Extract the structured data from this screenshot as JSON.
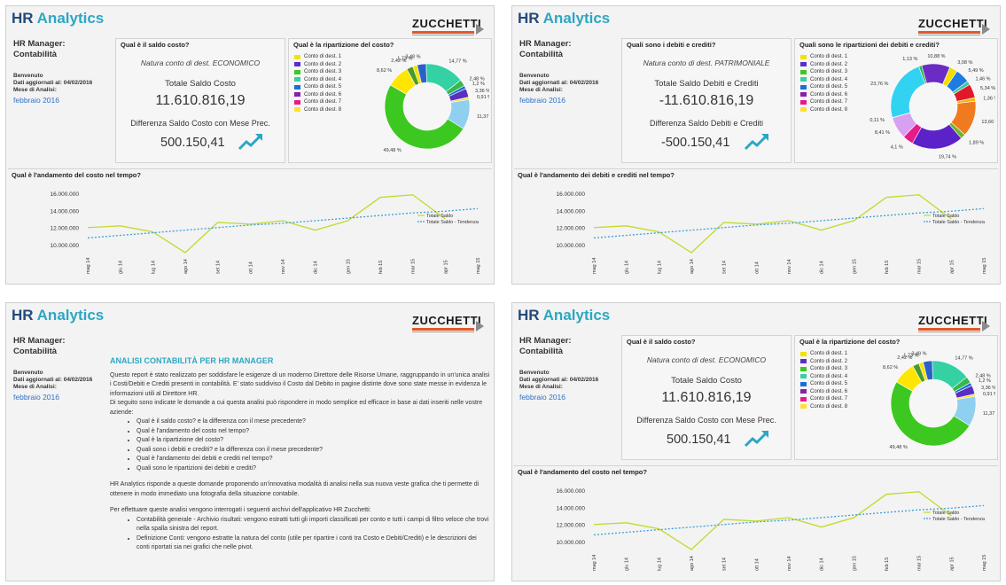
{
  "common": {
    "title_hr": "HR",
    "title_analytics": "Analytics",
    "logo": "ZUCCHETTI",
    "manager_line1": "HR Manager:",
    "manager_line2": "Contabilità",
    "welcome": "Benvenuto",
    "updated": "Dati aggiornati al: 04/02/2016",
    "month_label": "Mese di Analisi:",
    "month_value": "febbraio 2016",
    "trend_up_icon": "trend-up-arrow",
    "colors": {
      "title_dark": "#244a79",
      "title_accent": "#2ca7c3",
      "month_link": "#2f71c8",
      "trend_line": "#c2d92a",
      "regression_line": "#3a9fd8"
    }
  },
  "panel_cost": {
    "q1": "Qual è il saldo costo?",
    "nature": "Natura conto di dest. ECONOMICO",
    "total_label": "Totale Saldo Costo",
    "total_value": "11.610.816,19",
    "diff_label": "Differenza Saldo Costo con Mese Prec.",
    "diff_value": "500.150,41",
    "q2": "Qual è la ripartizione del costo?",
    "q3": "Qual è l'andamento  del costo nel tempo?"
  },
  "panel_debts": {
    "q1": "Quali sono i debiti e crediti?",
    "nature": "Natura conto di dest. PATRIMONIALE",
    "total_label": "Totale Saldo Debiti e Crediti",
    "total_value": "-11.610.816,19",
    "diff_label": "Differenza Saldo Debiti e Crediti",
    "diff_value": "-500.150,41",
    "q2": "Quali sono le ripartizioni dei debiti e crediti?",
    "q3": "Qual è l'andamento  dei debiti e crediti nel tempo?"
  },
  "panel_intro": {
    "heading": "ANALISI CONTABILITÀ PER HR MANAGER",
    "para1": "Questo report è stato realizzato per soddisfare le esigenze di un moderno Direttore delle Risorse Umane, raggruppando in un'unica analisi i Costi/Debiti e Crediti presenti in contabilità. E' stato suddiviso il Costo dal Debito in pagine distinte dove sono state messe in evidenza le informazioni utili al Direttore HR.",
    "para2": "Di seguito sono indicate le domande a cui questa analisi può rispondere in modo semplice ed efficace in base ai dati inseriti nelle vostre aziende:",
    "bullets1": [
      "Qual è il saldo costo? e la differenza con il mese precedente?",
      "Qual è l'andamento del costo nel tempo?",
      "Qual è la ripartizione del costo?",
      "Quali sono i debiti e crediti? e la differenza con il mese precedente?",
      "Qual è l'andamento dei debiti e crediti nel tempo?",
      "Quali sono le ripartizioni dei debiti e crediti?"
    ],
    "para3": "HR Analytics risponde a queste domande proponendo un'innovativa modalità di analisi nella sua nuova veste grafica che ti permette di ottenere in modo immediato una fotografia della situazione contabile.",
    "para4": "Per effettuare queste analisi vengono interrogati i seguenti archivi dell'applicativo HR Zucchetti:",
    "bullets2": [
      "Contabilità generale - Archivio risultati: vengono estratti tutti gli importi classificati per conto e tutti i campi di filtro veloce che trovi nella spalla sinistra del report.",
      "Definizione Conti: vengono estratte la natura del conto (utile per ripartire i conti tra Costo e Debiti/Crediti) e le descrizioni dei conti riportati sia nei grafici che nelle pivot."
    ]
  },
  "legend_labels": [
    "Conto di dest. 1",
    "Conto di dest. 2",
    "Conto di dest. 3",
    "Conto di dest. 4",
    "Conto di dest. 5",
    "Conto di dest. 6",
    "Conto di dest. 7",
    "Conto di dest. 8"
  ],
  "chart_data": [
    {
      "type": "pie",
      "title": "Qual è la ripartizione del costo?",
      "labels": [
        "1,73 %",
        "3,48 %",
        "14,77 %",
        "2,48 %",
        "1,2 %",
        "3,36 %",
        "0,91 %",
        "11,37 %",
        "49,48 %",
        "8,62 %",
        "2,42 %"
      ],
      "values": [
        1.73,
        3.48,
        14.77,
        2.48,
        1.2,
        3.36,
        0.91,
        11.37,
        49.48,
        8.62,
        2.42
      ],
      "colors": [
        "#f2e200",
        "#2d5fcc",
        "#34d1a5",
        "#38b84a",
        "#1a6fd6",
        "#5a2fc4",
        "#ffe030",
        "#8fd0f0",
        "#3cc820",
        "#ffe600",
        "#4a9a2a"
      ]
    },
    {
      "type": "pie",
      "title": "Quali sono le ripartizioni dei debiti e crediti?",
      "labels": [
        "1,13 %",
        "10,88 %",
        "3,08 %",
        "5,49 %",
        "1,46 %",
        "5,34 %",
        "1,36 %",
        "13,66 %",
        "1,89 %",
        "19,74 %",
        "4,1 %",
        "8,41 %",
        "0,11 %",
        "23,76 %"
      ],
      "values": [
        1.13,
        10.88,
        3.08,
        5.49,
        1.46,
        5.34,
        1.36,
        13.66,
        1.89,
        19.74,
        4.1,
        8.41,
        0.11,
        23.76
      ],
      "colors": [
        "#2fb640",
        "#6a2cc4",
        "#f2de00",
        "#1e7be0",
        "#39c9a0",
        "#e0182a",
        "#f5b700",
        "#f07a20",
        "#6ab82a",
        "#5a22c8",
        "#e81a8a",
        "#d8a0f0",
        "#9a9a9a",
        "#31d2f2"
      ]
    },
    {
      "type": "line",
      "title": "Qual è l'andamento  del costo nel tempo?",
      "x": [
        "mag 14",
        "giu 14",
        "lug 14",
        "ago 14",
        "set 14",
        "ott 14",
        "nov 14",
        "dic 14",
        "gen 15",
        "feb 15",
        "mar 15",
        "apr 15",
        "mag 15"
      ],
      "series": [
        {
          "name": "Totale Saldo",
          "values": [
            12100000,
            12300000,
            11600000,
            9200000,
            12700000,
            12500000,
            12900000,
            11800000,
            12900000,
            15600000,
            15900000,
            13100000,
            null
          ]
        },
        {
          "name": "Totale Saldo - Tendenza",
          "values": [
            10900000,
            11200000,
            11500000,
            11800000,
            12100000,
            12400000,
            12600000,
            12900000,
            13200000,
            13500000,
            13800000,
            14000000,
            14300000
          ]
        }
      ],
      "ylim": [
        9200000,
        16800000
      ],
      "yticks": [
        "16.000.000",
        "14.000.000",
        "12.000.000",
        "10.000.000"
      ],
      "ytick_values": [
        16000000,
        14000000,
        12000000,
        10000000
      ]
    }
  ]
}
